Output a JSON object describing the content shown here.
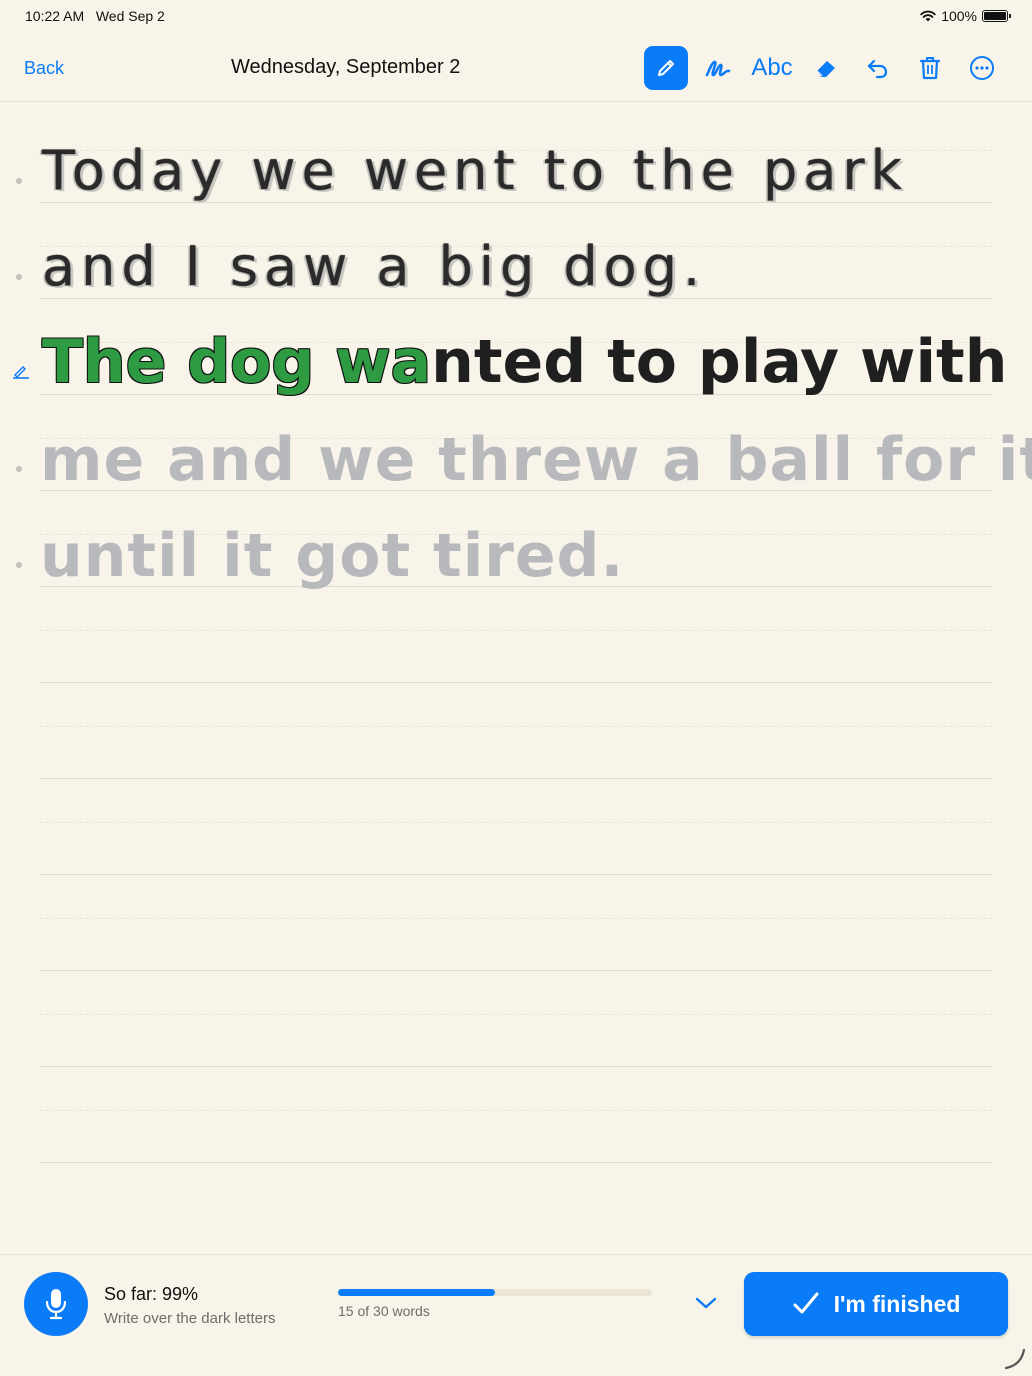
{
  "status_bar": {
    "time": "10:22 AM",
    "date": "Wed Sep 2",
    "battery": "100%",
    "wifi_icon": "wifi-icon",
    "battery_icon": "battery-icon"
  },
  "nav": {
    "back_label": "Back",
    "title": "Wednesday, September 2",
    "tools": [
      {
        "name": "pencil-icon",
        "active": true
      },
      {
        "name": "handwriting-icon",
        "active": false
      },
      {
        "name": "text-mode",
        "label": "Abc",
        "active": false
      },
      {
        "name": "eraser-icon",
        "active": false
      },
      {
        "name": "undo-icon",
        "active": false
      },
      {
        "name": "trash-icon",
        "active": false
      },
      {
        "name": "more-icon",
        "active": false
      }
    ]
  },
  "writing": {
    "completed_lines": [
      "Today we went to the park",
      "and I saw a big dog."
    ],
    "current_line": {
      "traced_parts": [
        "Th",
        "e ",
        "dog",
        " ",
        "wa"
      ],
      "text": "The dog wanted to play with",
      "traced": "The dog wa",
      "remaining": "nted to play with"
    },
    "upcoming_lines": [
      "me and we threw a ball for it",
      "until it got tired."
    ]
  },
  "bottom": {
    "score_label": "So far: 99%",
    "hint": "Write over the dark letters",
    "progress_label": "15 of 30 words",
    "progress": 0.5,
    "finish_label": "I'm finished"
  },
  "colors": {
    "accent": "#0a7cf7",
    "background": "#f9f4ea",
    "traced_green": "#2e9b43",
    "ghost_text": "#b7b9bc"
  }
}
